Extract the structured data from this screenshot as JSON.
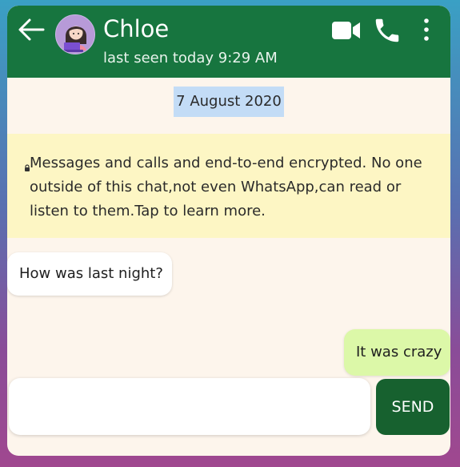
{
  "header": {
    "contact_name": "Chloe",
    "last_seen": "last seen today 9:29 AM",
    "icons": [
      "back-arrow-icon",
      "avatar",
      "video-camera-icon",
      "phone-icon",
      "more-vert-icon"
    ],
    "background_color": "#17753f"
  },
  "chat": {
    "date_chip": "7 August 2020",
    "encryption_notice": "Messages and calls and end-to-end encrypted. No one outside of this chat,not even WhatsApp,can read or listen to them.Tap to learn more.",
    "messages": [
      {
        "direction": "incoming",
        "text": "How was last night?"
      },
      {
        "direction": "outgoing",
        "text": "It was crazy"
      }
    ],
    "background_color": "#fdf5ec"
  },
  "composer": {
    "input_value": "",
    "input_placeholder": "",
    "send_label": "SEND"
  },
  "colors": {
    "outgoing_bubble": "#dcf8a8",
    "incoming_bubble": "#ffffff",
    "date_chip": "#c3dcf6",
    "encryption_banner": "#fdf6c4",
    "send_button": "#17612f"
  }
}
